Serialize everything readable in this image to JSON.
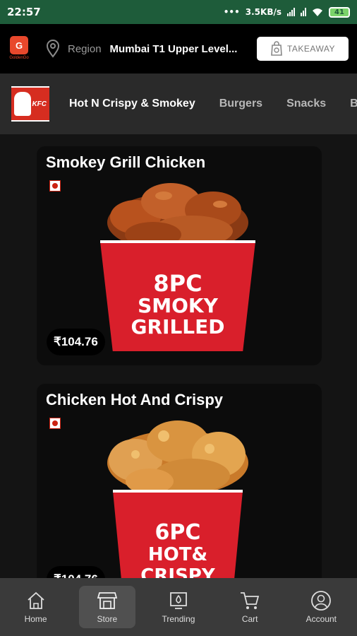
{
  "status_bar": {
    "time": "22:57",
    "network_speed": "3.5KB/s",
    "battery": "41"
  },
  "header": {
    "logo_text": "G",
    "logo_sub": "GoldenGo",
    "region_label": "Region",
    "region_value": "Mumbai T1 Upper Level...",
    "takeaway_label": "TAKEAWAY",
    "icons": [
      "location-pin-icon",
      "takeaway-bag-icon"
    ]
  },
  "categories": {
    "brand_label": "KFC",
    "items": [
      {
        "label": "Hot N Crispy & Smokey",
        "active": true
      },
      {
        "label": "Burgers",
        "active": false
      },
      {
        "label": "Snacks",
        "active": false
      },
      {
        "label": "B",
        "active": false
      }
    ]
  },
  "products": [
    {
      "name": "Smokey Grill Chicken",
      "price": "₹104.76",
      "bucket_line1": "8PC",
      "bucket_line2": "SMOKY",
      "bucket_line3": "GRILLED",
      "chicken_color": "#b8521e"
    },
    {
      "name": "Chicken Hot And Crispy",
      "price": "₹104.76",
      "bucket_line1": "6PC",
      "bucket_line2": "HOT&",
      "bucket_line3": "CRISPY",
      "chicken_color": "#d9892f"
    }
  ],
  "bottom_nav": [
    {
      "label": "Home",
      "icon": "home-icon",
      "active": false
    },
    {
      "label": "Store",
      "icon": "store-icon",
      "active": true
    },
    {
      "label": "Trending",
      "icon": "trending-icon",
      "active": false
    },
    {
      "label": "Cart",
      "icon": "cart-icon",
      "active": false
    },
    {
      "label": "Account",
      "icon": "account-icon",
      "active": false
    }
  ],
  "colors": {
    "status_bar": "#1e5c3a",
    "accent_red": "#d62d20",
    "logo_orange": "#e8482c"
  }
}
